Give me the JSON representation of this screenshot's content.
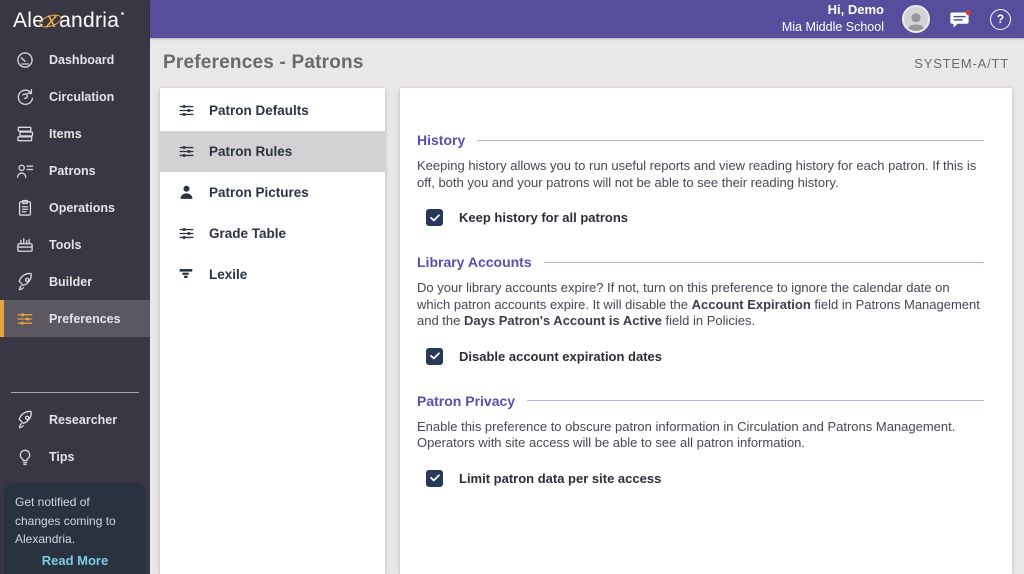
{
  "brand": {
    "logo_pre": "Ale",
    "logo_x": "x",
    "logo_post": "andria"
  },
  "topbar": {
    "greeting": "Hi, Demo",
    "site": "Mia Middle School"
  },
  "glyphs": {
    "help": "?"
  },
  "titlebar": {
    "title": "Preferences - Patrons",
    "system_label": "SYSTEM-A/TT"
  },
  "sidebar": {
    "items": [
      {
        "label": "Dashboard",
        "icon": "gauge"
      },
      {
        "label": "Circulation",
        "icon": "circular-arrows"
      },
      {
        "label": "Items",
        "icon": "book-stack"
      },
      {
        "label": "Patrons",
        "icon": "person-list"
      },
      {
        "label": "Operations",
        "icon": "clipboard"
      },
      {
        "label": "Tools",
        "icon": "toolbox"
      },
      {
        "label": "Builder",
        "icon": "rocket"
      },
      {
        "label": "Preferences",
        "icon": "sliders",
        "selected": true
      }
    ],
    "footer_items": [
      {
        "label": "Researcher",
        "icon": "rocket"
      },
      {
        "label": "Tips",
        "icon": "lightbulb"
      }
    ],
    "notice": {
      "text": "Get notified of changes coming to Alexandria.",
      "link": "Read More"
    }
  },
  "subnav": {
    "items": [
      {
        "label": "Patron Defaults",
        "icon": "sliders"
      },
      {
        "label": "Patron Rules",
        "icon": "sliders",
        "selected": true
      },
      {
        "label": "Patron Pictures",
        "icon": "person-solid"
      },
      {
        "label": "Grade Table",
        "icon": "sliders"
      },
      {
        "label": "Lexile",
        "icon": "lexile-podium"
      }
    ]
  },
  "sections": [
    {
      "title": "History",
      "description": [
        {
          "text": "Keeping history allows you to run useful reports and view reading history for each patron. If this is off, both you and your patrons will not be able to see their reading history."
        }
      ],
      "checkbox": {
        "checked": true,
        "label": "Keep history for all patrons"
      }
    },
    {
      "title": "Library Accounts",
      "description": [
        {
          "text": "Do your library accounts expire? If not, turn on this preference to ignore the calendar date on which patron accounts expire. It will disable the "
        },
        {
          "text": "Account Expiration",
          "bold": true
        },
        {
          "text": " field in Patrons Management and the "
        },
        {
          "text": "Days Patron's Account is Active",
          "bold": true
        },
        {
          "text": " field in Policies."
        }
      ],
      "checkbox": {
        "checked": true,
        "label": "Disable account expiration dates"
      }
    },
    {
      "title": "Patron Privacy",
      "description": [
        {
          "text": "Enable this preference to obscure patron information in Circulation and Patrons Management. Operators with site access will be able to see all patron information."
        }
      ],
      "checkbox": {
        "checked": true,
        "label": "Limit patron data per site access"
      }
    }
  ],
  "colors": {
    "topbar_purple": "#564d9c",
    "section_title_purple": "#5b4eb3",
    "sidebar_dark": "#3a3744",
    "selected_nav_gray": "#5b5862",
    "accent_orange": "#e8a33d",
    "checkbox_navy": "#27395a",
    "readmore_cyan": "#7fcbe0",
    "notification_dot_red": "#d63b2f",
    "page_background": "#e9e7e8"
  }
}
